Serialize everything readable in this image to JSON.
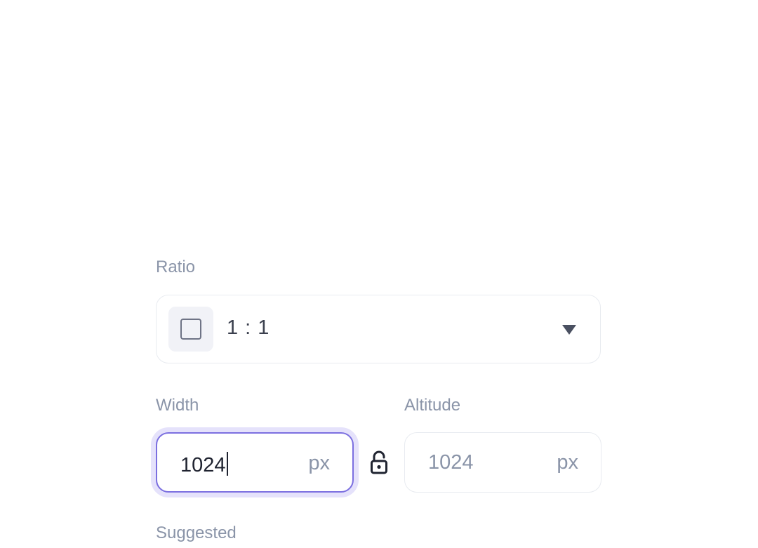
{
  "ratio": {
    "label": "Ratio",
    "selected": "1 : 1",
    "icon": "square-ratio-icon"
  },
  "width": {
    "label": "Width",
    "value": "1024",
    "unit": "px"
  },
  "altitude": {
    "label": "Altitude",
    "value": "1024",
    "unit": "px"
  },
  "lock_icon": "unlocked-padlock-icon",
  "suggested": {
    "label": "Suggested"
  },
  "colors": {
    "focus_border": "#7b6fe0",
    "focus_ring": "#e5e2fb",
    "label_text": "#8a94a8"
  }
}
